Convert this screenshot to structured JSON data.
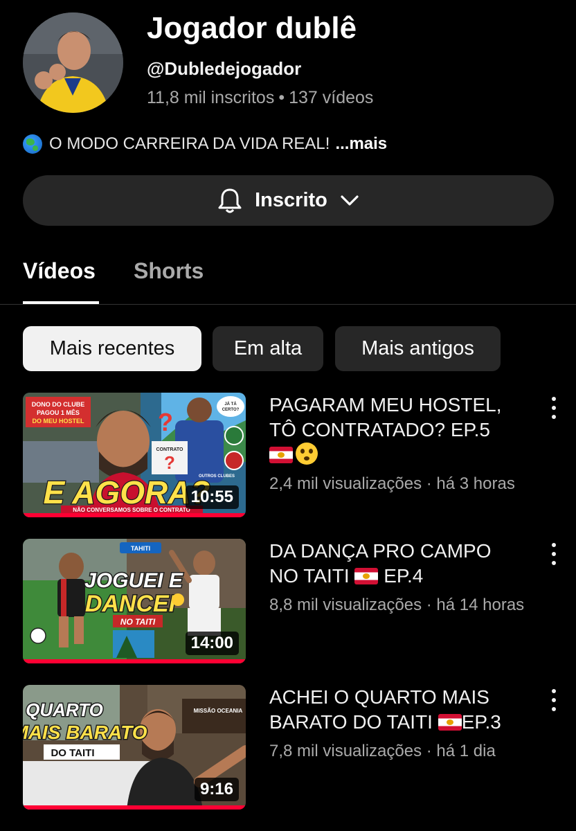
{
  "channel": {
    "name": "Jogador dublê",
    "handle": "@Dubledejogador",
    "subscribers": "11,8 mil inscritos",
    "separator": "•",
    "video_count": "137 vídeos",
    "description": "O MODO CARREIRA DA VIDA REAL!",
    "description_more": "...mais",
    "description_icon": "globe-emoji"
  },
  "subscribe": {
    "label": "Inscrito",
    "icons": [
      "bell-icon",
      "chevron-down-icon"
    ]
  },
  "tabs": [
    {
      "label": "Vídeos",
      "selected": true
    },
    {
      "label": "Shorts",
      "selected": false
    }
  ],
  "filters": [
    {
      "label": "Mais recentes",
      "selected": true
    },
    {
      "label": "Em alta",
      "selected": false
    },
    {
      "label": "Mais antigos",
      "selected": false
    }
  ],
  "videos": [
    {
      "title_line1": "PAGARAM MEU HOSTEL,",
      "title_line2": "TÔ CONTRATADO? EP.5",
      "meta": "2,4 mil visualizações · há 3 horas",
      "duration": "10:55",
      "thumb_text_main": "E AGORA?",
      "thumb_text_banner": "DONO DO CLUBE PAGOU 1 MÊS DO MEU HOSTEL",
      "thumb_text_bottom": "NÃO CONVERSAMOS SOBRE O CONTRATO",
      "thumb_text_bubble": "JÁ TÁ CERTO?",
      "thumb_text_contract": "CONTRATO",
      "thumb_text_clubs": "OUTROS CLUBES",
      "watch_progress": 1.0
    },
    {
      "title_line1": "DA DANÇA PRO CAMPO",
      "title_line2": "NO TAITI",
      "title_line2_suffix": "EP.4",
      "meta": "8,8 mil visualizações · há 14 horas",
      "duration": "14:00",
      "thumb_text_main1": "JOGUEI E",
      "thumb_text_main2": "DANCEI",
      "thumb_text_sub": "NO TAITI",
      "thumb_text_location": "TAHITI",
      "watch_progress": 1.0
    },
    {
      "title_line1": "ACHEI O QUARTO MAIS",
      "title_line2": "BARATO DO TAITI",
      "title_line2_suffix": "EP.3",
      "meta": "7,8 mil visualizações · há 1 dia",
      "duration": "9:16",
      "thumb_text_main1": "QUARTO",
      "thumb_text_main2": "MAIS BARATO",
      "thumb_text_sub": "DO TAITI",
      "thumb_text_corner": "MISSÃO OCEANIA",
      "watch_progress": 1.0
    }
  ],
  "colors": {
    "background": "#000000",
    "chip_selected": "#f1f1f1",
    "chip_default": "#272727",
    "secondary_text": "#aaaaaa",
    "progress": "#ff0033"
  }
}
